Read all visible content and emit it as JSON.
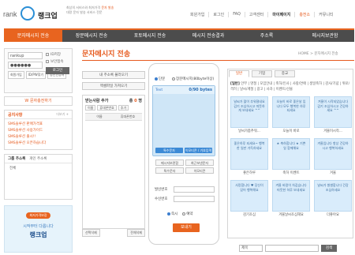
{
  "header": {
    "logo_prefix": "rank",
    "logo_brand": "랭크업",
    "tagline_line1": "최상의 서비스와 최저가격",
    "tagline_highlight": "문자 발송",
    "tagline_line2": "대량 문자 발송 서비스 전문",
    "links": [
      "회원가입",
      "로그인",
      "FAQ",
      "고객센터",
      "마이페이지",
      "충전소",
      "커뮤니티"
    ],
    "highlight_link": "충전소",
    "bold_link": "마이페이지"
  },
  "nav": {
    "items": [
      "문자메시지 전송",
      "장문메시지 전송",
      "포토메시지 전송",
      "메시지 전송결과",
      "주소록",
      "메시지보관함"
    ],
    "active_index": 0
  },
  "login": {
    "id_value": "rankup",
    "pw_value": "●●●●●●",
    "save_id": "ID저장",
    "secure": "보안접속",
    "ok_label": "로그인",
    "links": [
      "회원가입",
      "ID/PW찾기",
      "공인인증서"
    ]
  },
  "free_button": "W 문자충전하기",
  "notice": {
    "title": "공지사항",
    "more": "더보기 +",
    "items": [
      "SMS솔루션 판매가격표",
      "SMS솔루션 사용가이드",
      "SMS솔루션 출시!!",
      "SMS솔루션 오픈하습니다"
    ]
  },
  "groups": {
    "tabs": [
      "그룹 주소록",
      "개인 주소록"
    ],
    "item": "전체"
  },
  "ad": {
    "badge": "최저가격보장",
    "line": "시작부터 다릅니다",
    "brand": "랭크업"
  },
  "page": {
    "title": "문자메시지 전송",
    "breadcrumb": "HOME > 문자메시지 전송"
  },
  "recipients": {
    "btn_load": "내 주소록 불러오기",
    "btn_excel": "엑셀파일 가져오기",
    "title": "받는사람 추가",
    "count_label": "총",
    "count": "0",
    "count_unit": "명",
    "input_name": "이름",
    "input_phone": "휴대폰번호",
    "input_add": "추가",
    "col_name": "이름",
    "col_phone": "휴대폰번호",
    "footer_left": "선택삭제",
    "footer_right": "전체삭제"
  },
  "phone": {
    "radio_sms": "단문",
    "radio_lms": "장문메시지(80byte이상)",
    "screen_label": "Text",
    "bytes": "0/90 bytes",
    "screen_btns": [
      "특수문자",
      "이모티콘 / 기호입력"
    ],
    "options": [
      "메시지보관함",
      "최근보낸문자",
      "특수문자",
      "이모티콘"
    ],
    "field_from": "발신번호",
    "field_to": "수신번호",
    "send_now": "즉시",
    "send_reserve": "예약",
    "send_btn": "보내기"
  },
  "templates": {
    "tabs": [
      "일반",
      "기업",
      "종교"
    ],
    "active_tab": 0,
    "categories_lead": "[일반]",
    "categories": "안부 | 명절 | 모임안내 | 축하/인사 | 사랑/연애 | 생일축하 | 감사/기념 | 위로/격려 | 날씨/계절 | 광고 | 사과 | 이벤트/선물",
    "cards": [
      {
        "text": "날씨가 많이 추워졌네요 감기 조심하시고 따뜻하게 보내세요 ^^",
        "caption": "날씨가좀추워..."
      },
      {
        "text": "오늘이 바로 좋은날 입니다 모두 행복한 하루 되세요",
        "caption": "오늘이 바로"
      },
      {
        "text": "겨울이 시작되었습니다 감기 조심하시고 건강하세요 ^^",
        "caption": "겨울이시작..."
      },
      {
        "text": "좋은하루 되세요~ 행복한 일만 가득하세요",
        "caption": "좋은하루"
      },
      {
        "text": "★ 축하합니다 ★ 기쁜 일 함께해요",
        "caption": "축하 이벤트"
      },
      {
        "text": "겨울입니다 항상 건강하시고 행복하세요",
        "caption": "겨울"
      },
      {
        "text": "사랑합니다 ♥ 당신이 있어 행복해요",
        "caption": "감기조심"
      },
      {
        "text": "겨울 바람이 차갑습니다 따뜻한 하루 보내세요",
        "caption": "겨울날씨조심해요"
      },
      {
        "text": "날씨가 쌀쌀합니다 건강 조심하세요",
        "caption": "더좋아요"
      }
    ]
  },
  "search": {
    "select": "제목",
    "button": "검색"
  }
}
